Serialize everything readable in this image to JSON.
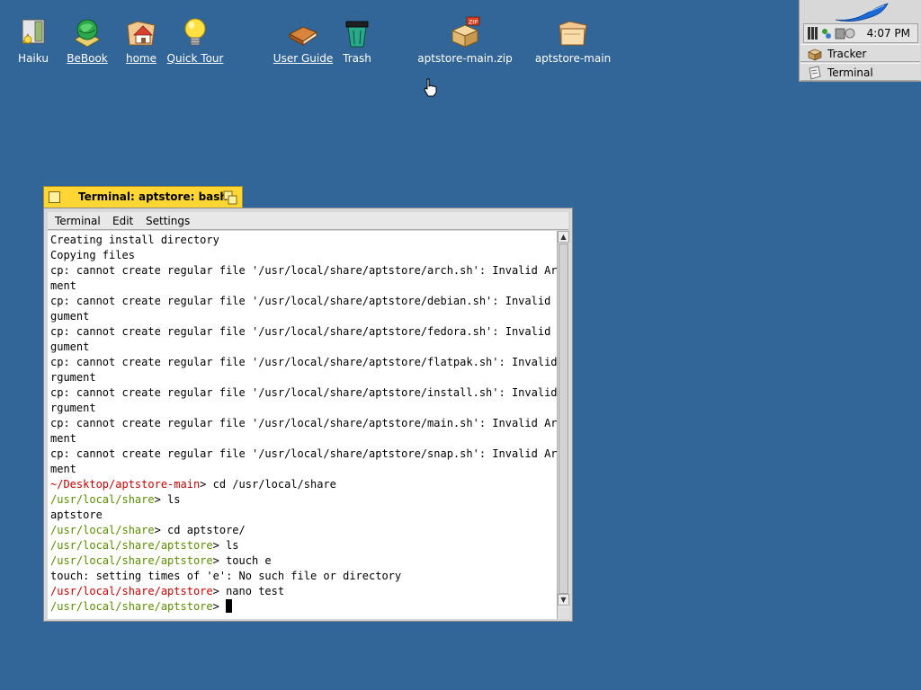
{
  "desktop": {
    "icons": [
      {
        "label": "Haiku",
        "icon": "haiku-disk-icon"
      },
      {
        "label": "BeBook",
        "icon": "bebook-globe-icon"
      },
      {
        "label": "home",
        "icon": "home-folder-icon"
      },
      {
        "label": "Quick Tour",
        "icon": "lightbulb-icon"
      },
      {
        "label": "User Guide",
        "icon": "book-icon"
      },
      {
        "label": "Trash",
        "icon": "trash-icon"
      },
      {
        "label": "aptstore-main.zip",
        "icon": "zip-package-icon"
      },
      {
        "label": "aptstore-main",
        "icon": "folder-icon"
      }
    ],
    "background_color": "#336698"
  },
  "deskbar": {
    "clock": "4:07 PM",
    "apps": [
      {
        "label": "Tracker",
        "icon": "tracker-icon"
      },
      {
        "label": "Terminal",
        "icon": "terminal-icon"
      }
    ]
  },
  "terminal": {
    "title": "Terminal: aptstore: bash",
    "tab_color": "#ffd633",
    "menu": [
      "Terminal",
      "Edit",
      "Settings"
    ],
    "lines": [
      {
        "text": "Creating install directory"
      },
      {
        "text": "Copying files"
      },
      {
        "text": "cp: cannot create regular file '/usr/local/share/aptstore/arch.sh': Invalid Argu"
      },
      {
        "text": "ment"
      },
      {
        "text": "cp: cannot create regular file '/usr/local/share/aptstore/debian.sh': Invalid Ar"
      },
      {
        "text": "gument"
      },
      {
        "text": "cp: cannot create regular file '/usr/local/share/aptstore/fedora.sh': Invalid Ar"
      },
      {
        "text": "gument"
      },
      {
        "text": "cp: cannot create regular file '/usr/local/share/aptstore/flatpak.sh': Invalid A"
      },
      {
        "text": "rgument"
      },
      {
        "text": "cp: cannot create regular file '/usr/local/share/aptstore/install.sh': Invalid A"
      },
      {
        "text": "rgument"
      },
      {
        "text": "cp: cannot create regular file '/usr/local/share/aptstore/main.sh': Invalid Argu"
      },
      {
        "text": "ment"
      },
      {
        "text": "cp: cannot create regular file '/usr/local/share/aptstore/snap.sh': Invalid Argu"
      },
      {
        "text": "ment"
      },
      {
        "prompt": "~/Desktop/aptstore-main",
        "prompt_color": "red",
        "cmd": "> cd /usr/local/share"
      },
      {
        "prompt": "/usr/local/share",
        "prompt_color": "green",
        "cmd": "> ls"
      },
      {
        "text": "aptstore"
      },
      {
        "prompt": "/usr/local/share",
        "prompt_color": "green",
        "cmd": "> cd aptstore/"
      },
      {
        "prompt": "/usr/local/share/aptstore",
        "prompt_color": "green",
        "cmd": "> ls"
      },
      {
        "prompt": "/usr/local/share/aptstore",
        "prompt_color": "green",
        "cmd": "> touch e"
      },
      {
        "text": "touch: setting times of 'e': No such file or directory"
      },
      {
        "prompt": "/usr/local/share/aptstore",
        "prompt_color": "red",
        "cmd": "> nano test"
      },
      {
        "prompt": "/usr/local/share/aptstore",
        "prompt_color": "green",
        "cmd": "> ",
        "cursor": true
      }
    ]
  }
}
